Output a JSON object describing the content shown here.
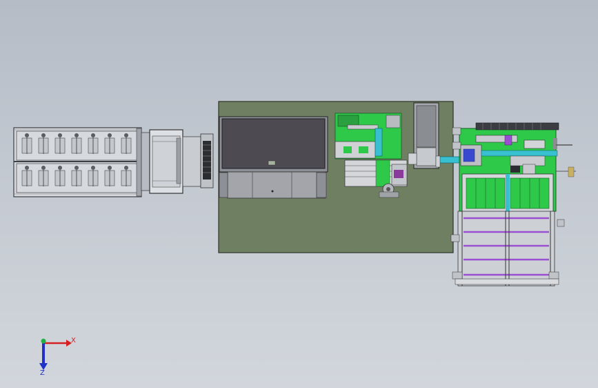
{
  "triad": {
    "x_label": "X",
    "z_label": "Z",
    "x_color": "#d42020",
    "z_color": "#2030c8",
    "y_color": "#20b040"
  },
  "colors": {
    "background": "#c0c6ce",
    "machine_base": "#6e7f62",
    "pcb_green": "#2fc94a",
    "frame_gray": "#8a8e94",
    "cabinet_dark": "#4d4a52",
    "purple_rail": "#9a4fd0",
    "cyan_part": "#39c0d0"
  }
}
